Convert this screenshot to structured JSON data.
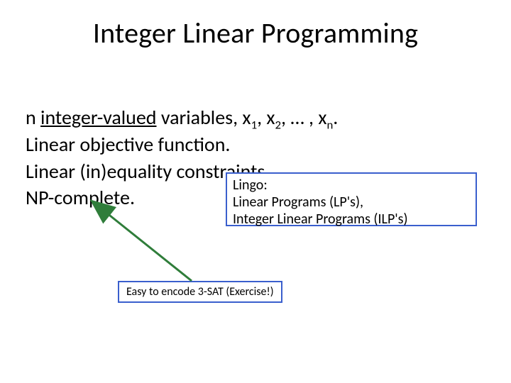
{
  "title": "Integer Linear Programming",
  "body": {
    "line1_pre": "n ",
    "line1_underlined": "integer-valued",
    "line1_post": " variables, x",
    "line1_sub1": "1",
    "line1_mid1": ", x",
    "line1_sub2": "2",
    "line1_mid2": ", … , x",
    "line1_subn": "n",
    "line1_end": ".",
    "line2": "Linear objective function.",
    "line3": "Linear (in)equality constraints.",
    "line4": "NP-complete."
  },
  "callout": {
    "l1": "Lingo:",
    "l2": "Linear Programs (LP's),",
    "l3": "Integer Linear Programs (ILP's)"
  },
  "smallbox": "Easy to encode 3-SAT (Exercise!)",
  "colors": {
    "accent": "#3a5fcd",
    "arrow": "#2f7d3a"
  }
}
